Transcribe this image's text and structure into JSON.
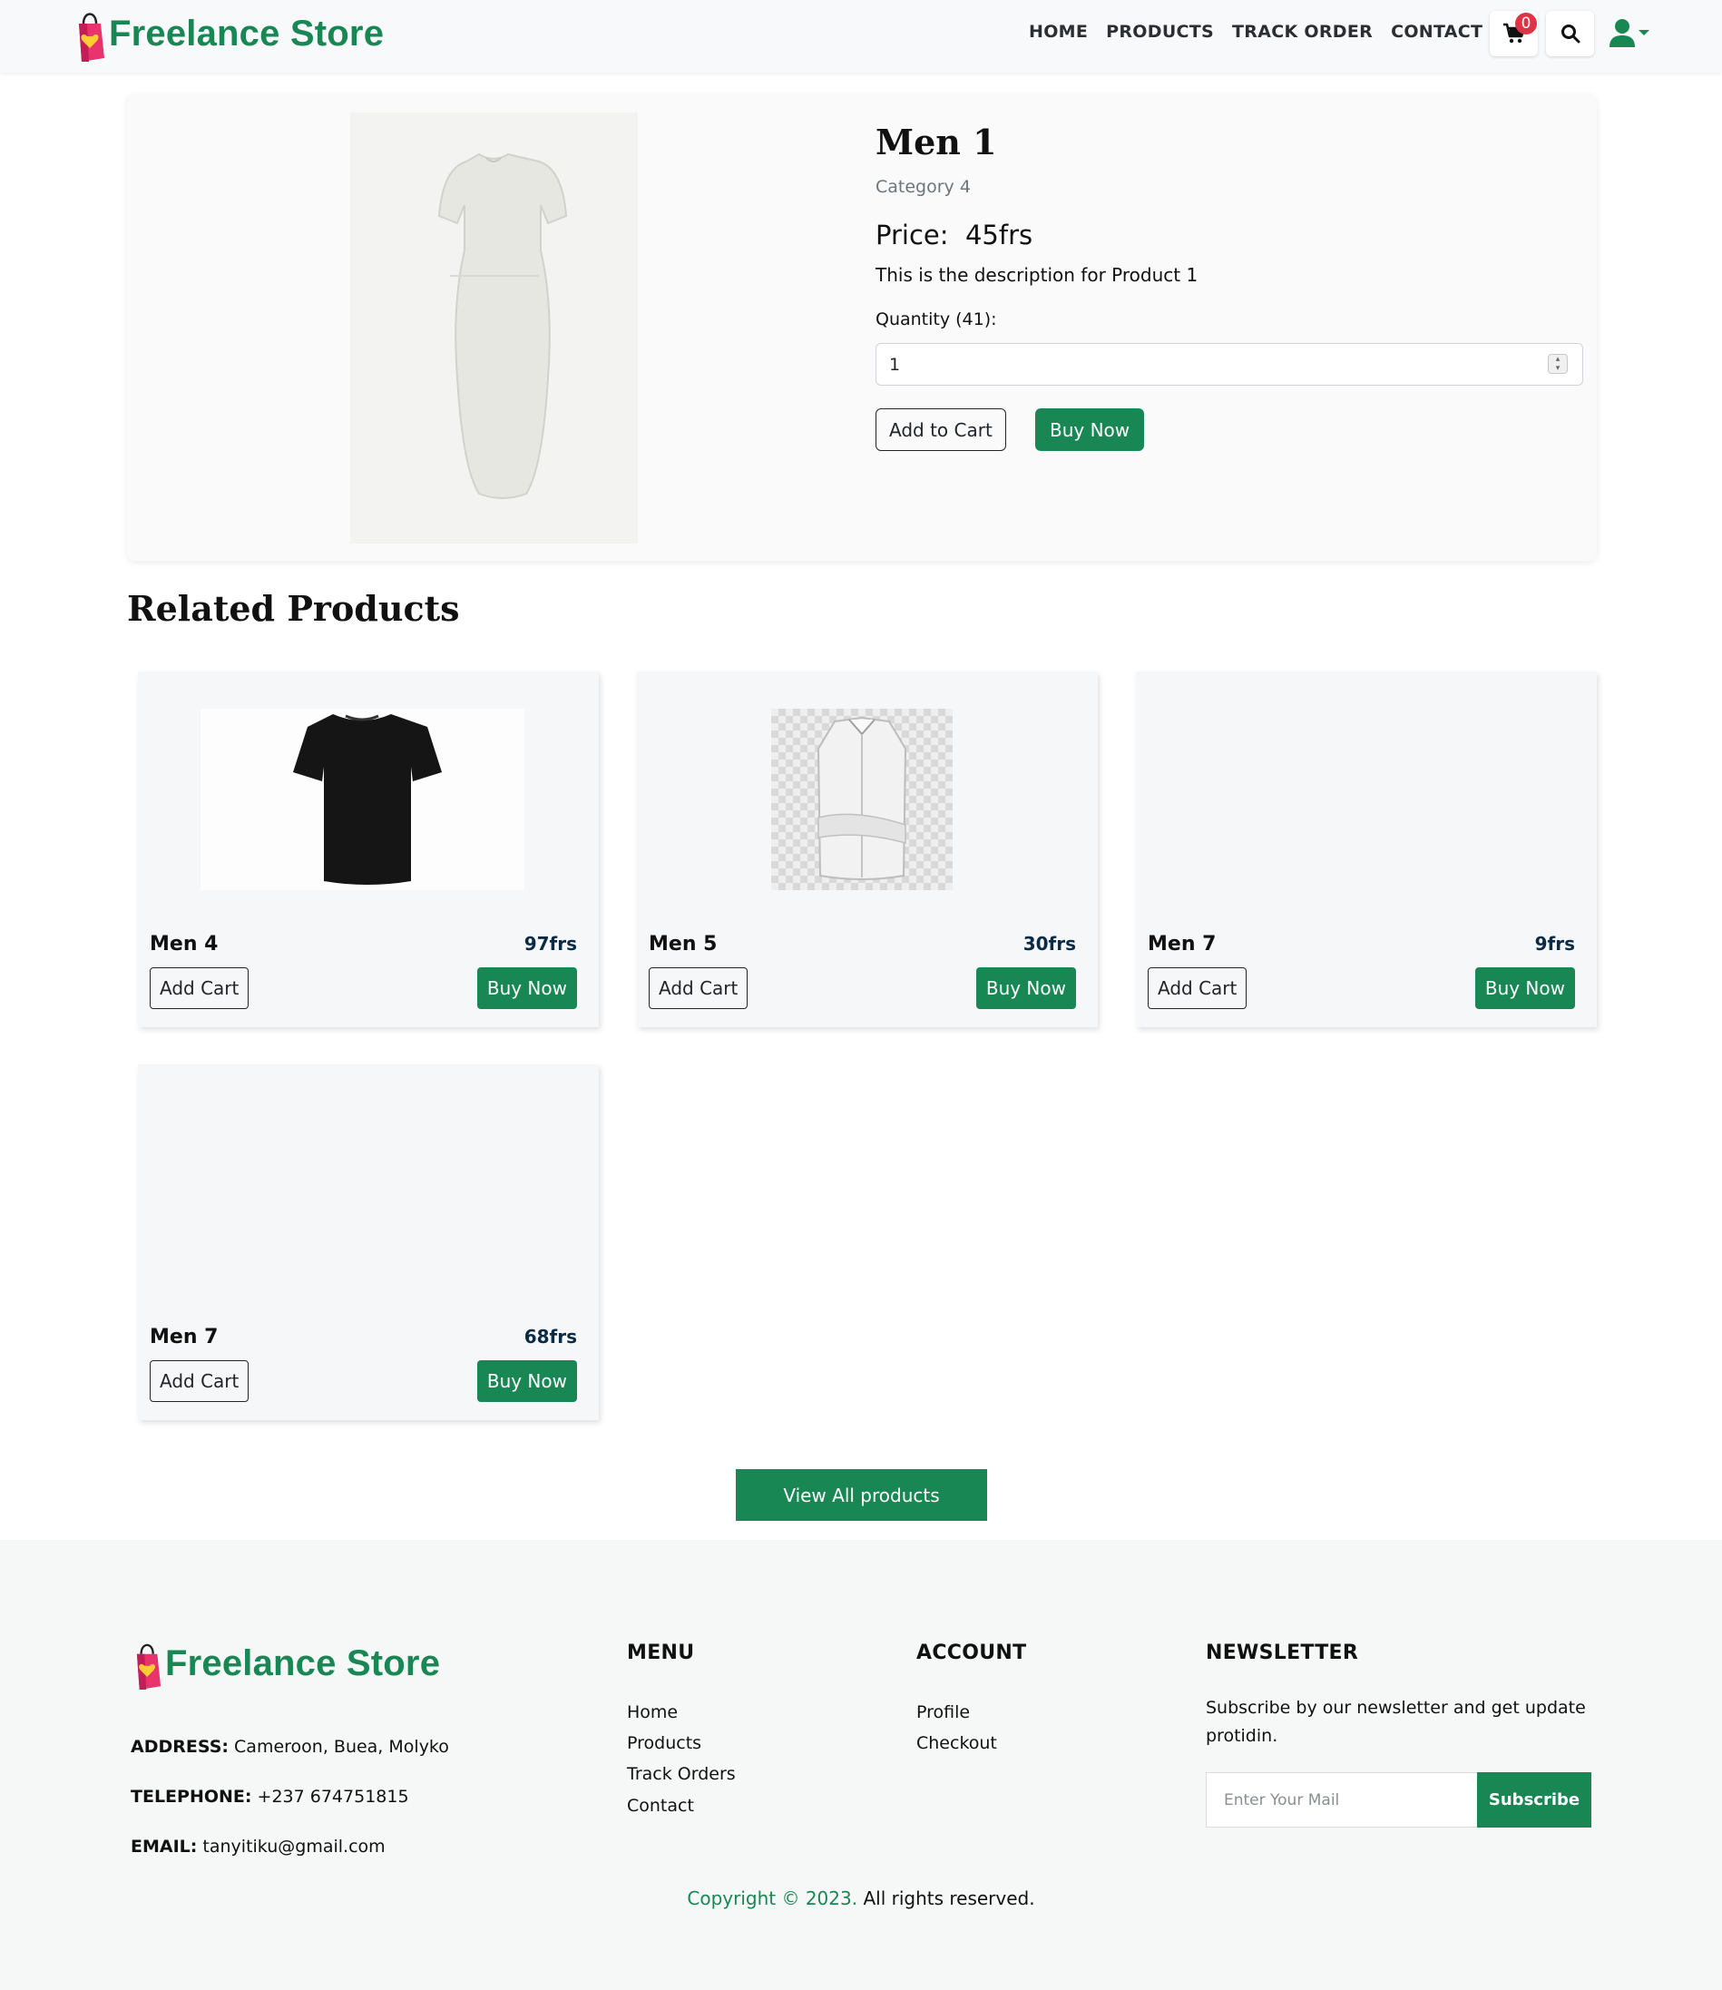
{
  "header": {
    "brand": "Freelance Store",
    "nav": [
      "HOME",
      "PRODUCTS",
      "TRACK ORDER",
      "CONTACT"
    ],
    "cart_count": "0"
  },
  "product": {
    "title": "Men 1",
    "category": "Category 4",
    "price_label": "Price:",
    "price": "45frs",
    "description": "This is the description for Product 1",
    "quantity_label": "Quantity (41):",
    "quantity_value": "1",
    "add_to_cart": "Add to Cart",
    "buy_now": "Buy Now"
  },
  "related": {
    "title": "Related Products",
    "items": [
      {
        "name": "Men 4",
        "price": "97frs",
        "add": "Add Cart",
        "buy": "Buy Now",
        "image": "black-tshirt"
      },
      {
        "name": "Men 5",
        "price": "30frs",
        "add": "Add Cart",
        "buy": "Buy Now",
        "image": "white-shirt"
      },
      {
        "name": "Men 7",
        "price": "9frs",
        "add": "Add Cart",
        "buy": "Buy Now",
        "image": "none"
      },
      {
        "name": "Men 7",
        "price": "68frs",
        "add": "Add Cart",
        "buy": "Buy Now",
        "image": "none"
      }
    ],
    "view_all": "View All products"
  },
  "footer": {
    "brand": "Freelance Store",
    "address_label": "ADDRESS:",
    "address": "Cameroon, Buea, Molyko",
    "telephone_label": "TELEPHONE:",
    "telephone": "+237 674751815",
    "email_label": "EMAIL:",
    "email": "tanyitiku@gmail.com",
    "menu_title": "MENU",
    "menu": [
      "Home",
      "Products",
      "Track Orders",
      "Contact"
    ],
    "account_title": "ACCOUNT",
    "account": [
      "Profile",
      "Checkout"
    ],
    "newsletter_title": "NEWSLETTER",
    "newsletter_text": "Subscribe by our newsletter and get update protidin.",
    "newsletter_placeholder": "Enter Your Mail",
    "subscribe": "Subscribe",
    "copyright_green": "Copyright © 2023.",
    "copyright_rest": " All rights reserved."
  },
  "colors": {
    "accent": "#198754",
    "badge": "#dc3545",
    "price_text": "#0b2b45"
  }
}
